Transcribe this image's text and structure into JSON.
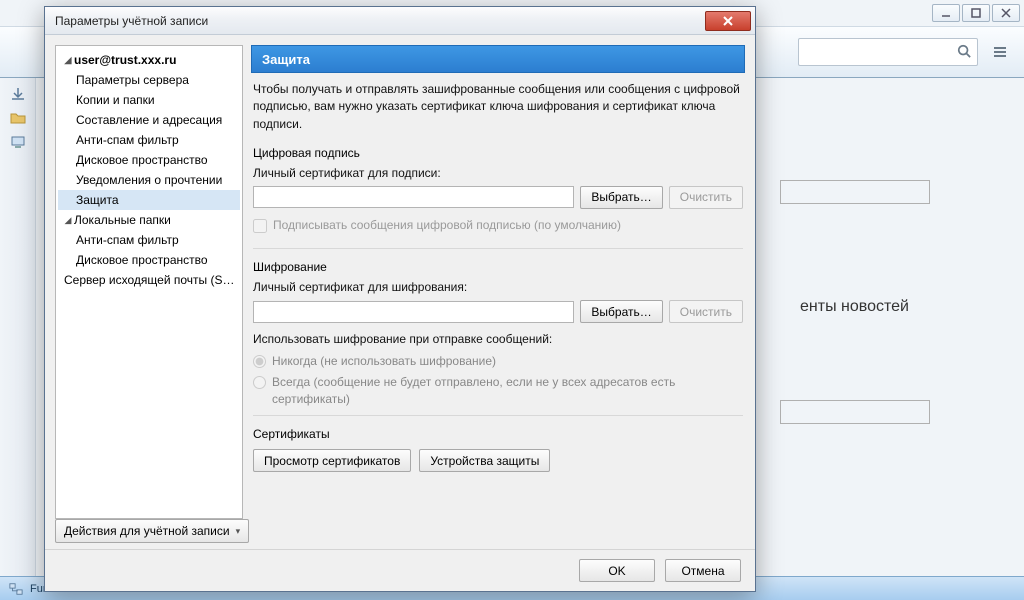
{
  "background": {
    "news_fragment": "енты новостей",
    "status_text": "Fun"
  },
  "dialog": {
    "title": "Параметры учётной записи",
    "tree": {
      "account": "user@trust.xxx.ru",
      "items": [
        "Параметры сервера",
        "Копии и папки",
        "Составление и адресация",
        "Анти-спам фильтр",
        "Дисковое пространство",
        "Уведомления о прочтении",
        "Защита"
      ],
      "local_folders": "Локальные папки",
      "local_items": [
        "Анти-спам фильтр",
        "Дисковое пространство"
      ],
      "smtp": "Сервер исходящей почты (S…"
    },
    "actions_btn": "Действия для учётной записи",
    "panel": {
      "header": "Защита",
      "intro": "Чтобы получать и отправлять зашифрованные сообщения или сообщения с цифровой подписью, вам нужно указать сертификат ключа шифрования и сертификат ключа подписи.",
      "sig_section": "Цифровая подпись",
      "sig_label": "Личный сертификат для подписи:",
      "choose": "Выбрать…",
      "clear": "Очистить",
      "sign_default": "Подписывать сообщения цифровой подписью (по умолчанию)",
      "enc_section": "Шифрование",
      "enc_label": "Личный сертификат для шифрования:",
      "enc_use_label": "Использовать шифрование при отправке сообщений:",
      "radio_never": "Никогда (не использовать шифрование)",
      "radio_always": "Всегда (сообщение не будет отправлено, если не у всех адресатов есть сертификаты)",
      "cert_section": "Сертификаты",
      "view_certs": "Просмотр сертификатов",
      "sec_devices": "Устройства защиты"
    },
    "ok": "OK",
    "cancel": "Отмена"
  }
}
